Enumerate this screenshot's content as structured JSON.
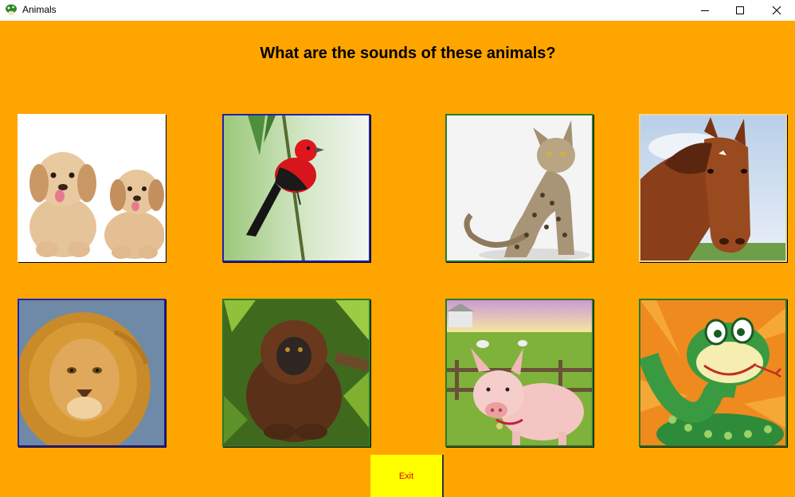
{
  "window": {
    "title": "Animals",
    "controls": {
      "minimize_icon": "minimize-icon",
      "maximize_icon": "maximize-icon",
      "close_icon": "close-icon"
    }
  },
  "main": {
    "heading": "What are the sounds of these animals?",
    "cards": [
      {
        "animal": "dogs",
        "border_color": "#ffffff"
      },
      {
        "animal": "bird",
        "border_color": "#2222aa"
      },
      {
        "animal": "cat",
        "border_color": "#2a7a2a"
      },
      {
        "animal": "horse",
        "border_color": "#e8d8a0"
      },
      {
        "animal": "lion",
        "border_color": "#2222aa"
      },
      {
        "animal": "monkey",
        "border_color": "#2a7a2a"
      },
      {
        "animal": "pig",
        "border_color": "#2a7a2a"
      },
      {
        "animal": "snake",
        "border_color": "#2a7a2a"
      }
    ],
    "exit_label": "Exit"
  },
  "colors": {
    "background": "#ffa500",
    "exit_bg": "#ffff00",
    "exit_text": "#e00000"
  }
}
